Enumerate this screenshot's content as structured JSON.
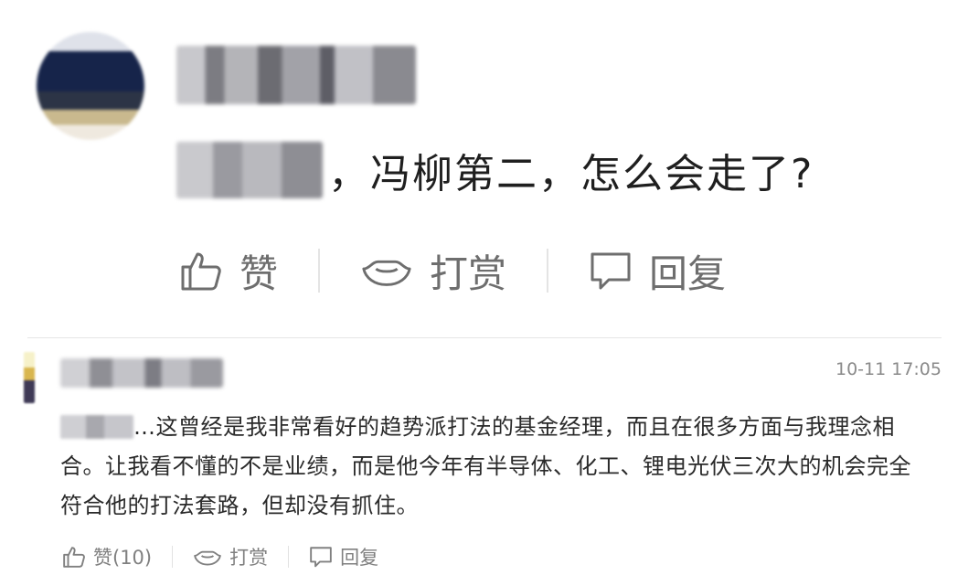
{
  "main_comment": {
    "text": "，冯柳第二，怎么会走了?",
    "actions": {
      "like_label": "赞",
      "tip_label": "打赏",
      "reply_label": "回复"
    }
  },
  "reply_comment": {
    "timestamp": "10-11 17:05",
    "text": "…这曾经是我非常看好的趋势派打法的基金经理，而且在很多方面与我理念相合。让我看不懂的不是业绩，而是他今年有半导体、化工、锂电光伏三次大的机会完全符合他的打法套路，但却没有抓住。",
    "actions": {
      "like_label": "赞(10)",
      "tip_label": "打赏",
      "reply_label": "回复"
    }
  },
  "icons": {
    "like": "thumbs-up-icon",
    "tip": "ingot-icon",
    "reply": "speech-bubble-icon"
  },
  "colors": {
    "action_gray": "#6e6e6e",
    "divider": "#e6e6e6",
    "timestamp": "#8a8a8a"
  }
}
